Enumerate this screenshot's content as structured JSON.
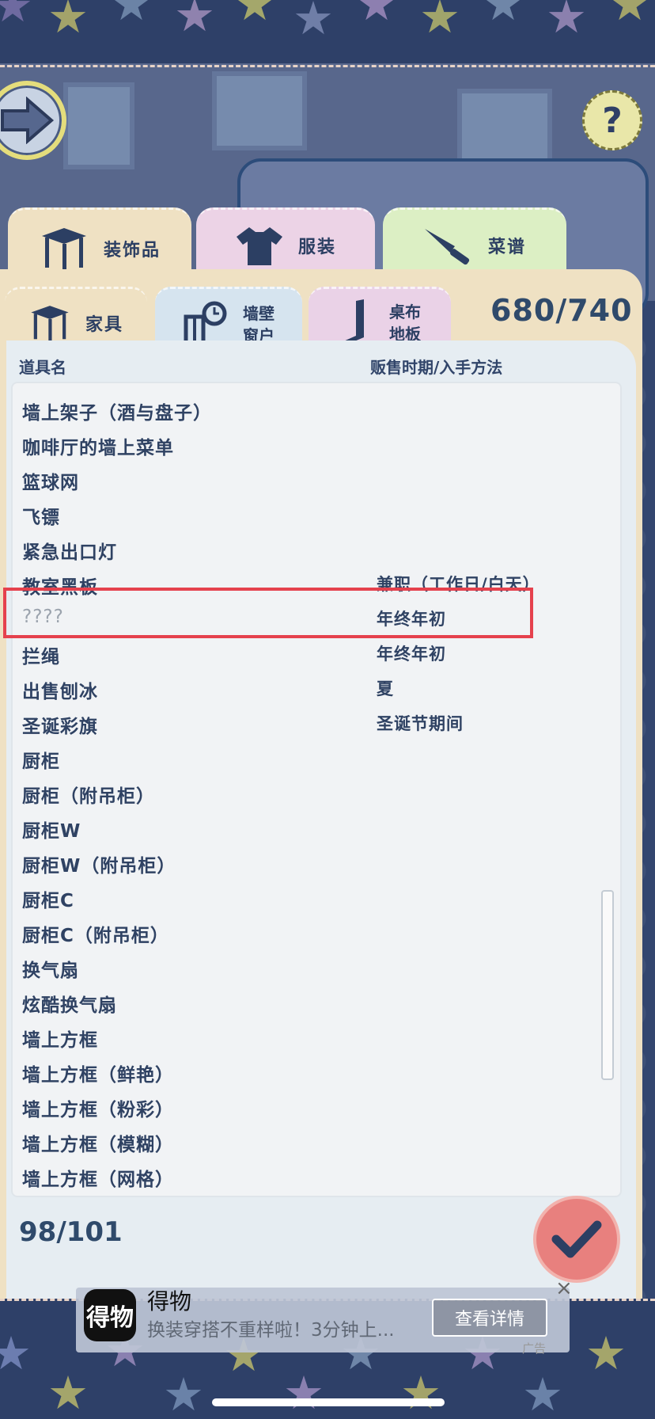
{
  "top_tabs": [
    {
      "label": "装饰品",
      "icon": "table-icon"
    },
    {
      "label": "服装",
      "icon": "shirt-icon"
    },
    {
      "label": "菜谱",
      "icon": "knife-icon"
    }
  ],
  "sub_tabs": [
    {
      "label": "家具",
      "icon": "table-icon"
    },
    {
      "label_line1": "墙壁",
      "label_line2": "窗户",
      "icon": "window-clock-icon"
    },
    {
      "label_line1": "桌布",
      "label_line2": "地板",
      "icon": "floor-icon"
    }
  ],
  "total_counter": "680/740",
  "list_header": {
    "name": "道具名",
    "time": "贩售时期/入手方法"
  },
  "rows": [
    {
      "name": "墙上架子（酒与盘子）",
      "time": ""
    },
    {
      "name": "咖啡厅的墙上菜单",
      "time": ""
    },
    {
      "name": "篮球网",
      "time": ""
    },
    {
      "name": "飞镖",
      "time": ""
    },
    {
      "name": "紧急出口灯",
      "time": ""
    },
    {
      "name": "教室黑板",
      "time": "兼职（工作日/白天）"
    },
    {
      "name": "????",
      "time": "年终年初"
    },
    {
      "name": "拦绳",
      "time": "年终年初"
    },
    {
      "name": "出售刨冰",
      "time": "夏"
    },
    {
      "name": "圣诞彩旗",
      "time": "圣诞节期间"
    },
    {
      "name": "厨柜",
      "time": ""
    },
    {
      "name": "厨柜（附吊柜）",
      "time": ""
    },
    {
      "name": "厨柜W",
      "time": ""
    },
    {
      "name": "厨柜W（附吊柜）",
      "time": ""
    },
    {
      "name": "厨柜C",
      "time": ""
    },
    {
      "name": "厨柜C（附吊柜）",
      "time": ""
    },
    {
      "name": "换气扇",
      "time": ""
    },
    {
      "name": "炫酷换气扇",
      "time": ""
    },
    {
      "name": "墙上方框",
      "time": ""
    },
    {
      "name": "墙上方框（鲜艳）",
      "time": ""
    },
    {
      "name": "墙上方框（粉彩）",
      "time": ""
    },
    {
      "name": "墙上方框（模糊）",
      "time": ""
    },
    {
      "name": "墙上方框（网格）",
      "time": ""
    }
  ],
  "category_counter": "98/101",
  "help_label": "?",
  "ad": {
    "icon_text": "得物",
    "title": "得物",
    "description": "换装穿搭不重样啦！3分钟上...",
    "button": "查看详情",
    "close": "×",
    "tag": "广告"
  },
  "colors": {
    "highlight": "#e5414d",
    "accent_text": "#2f4263"
  }
}
